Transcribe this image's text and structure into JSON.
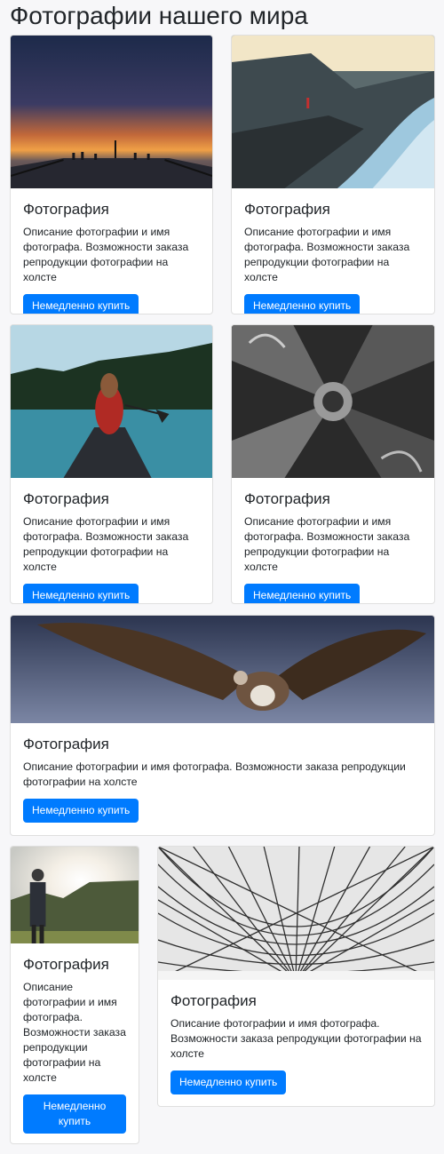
{
  "page": {
    "title": "Фотографии нашего мира"
  },
  "cards": [
    {
      "image": "sunset-pier-photo",
      "title": "Фотография",
      "text": "Описание фотографии и имя фотографа. Возможности заказа репродукции фотографии на холсте",
      "button": "Немедленно купить"
    },
    {
      "image": "fjord-cliff-photo",
      "title": "Фотография",
      "text": "Описание фотографии и имя фотографа. Возможности заказа репродукции фотографии на холсте",
      "button": "Немедленно купить"
    },
    {
      "image": "canoe-lake-photo",
      "title": "Фотография",
      "text": "Описание фотографии и имя фотографа. Возможности заказа репродукции фотографии на холсте",
      "button": "Немедленно купить"
    },
    {
      "image": "arch-ceiling-photo",
      "title": "Фотография",
      "text": "Описание фотографии и имя фотографа. Возможности заказа репродукции фотографии на холсте",
      "button": "Немедленно купить"
    },
    {
      "image": "vulture-photo",
      "title": "Фотография",
      "text": "Описание фотографии и имя фотографа. Возможности заказа репродукции фотографии на холсте",
      "button": "Немедленно купить"
    },
    {
      "image": "man-sunlight-photo",
      "title": "Фотография",
      "text": "Описание фотографии и имя фотографа. Возможности заказа репродукции фотографии на холсте",
      "button": "Немедленно купить"
    },
    {
      "image": "glass-roof-photo",
      "title": "Фотография",
      "text": "Описание фотографии и имя фотографа. Возможности заказа репродукции фотографии на холсте",
      "button": "Немедленно купить"
    }
  ],
  "colors": {
    "primary": "#007bff",
    "background": "#f7f7f9",
    "card_border": "rgba(0,0,0,0.125)"
  }
}
